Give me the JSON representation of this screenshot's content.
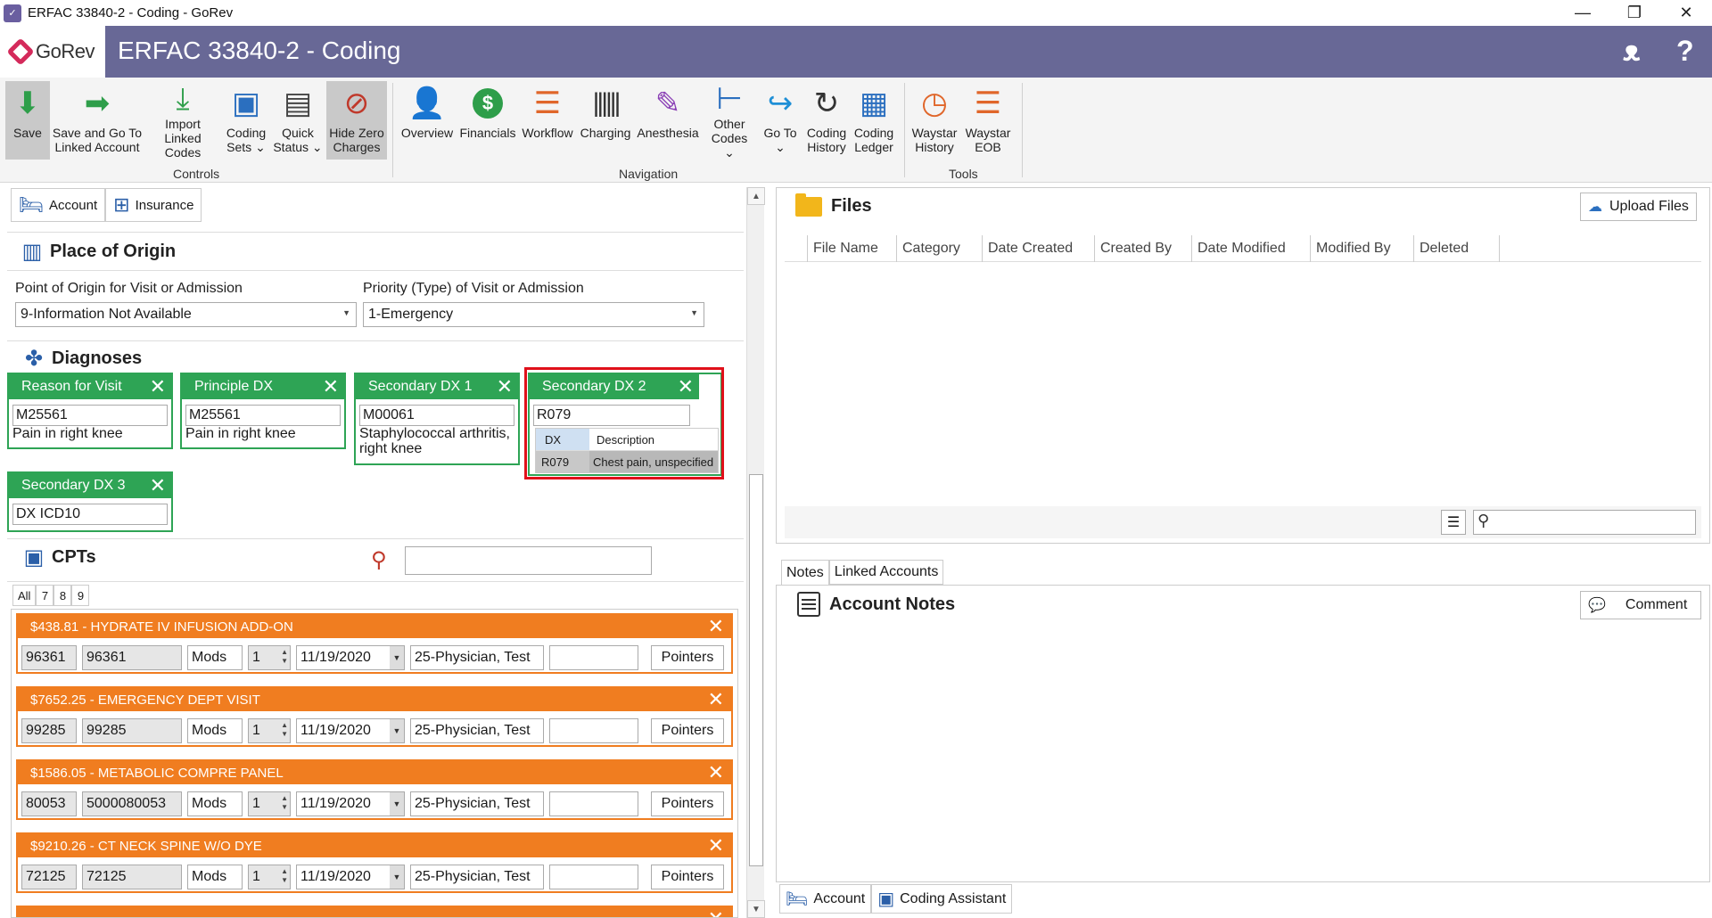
{
  "window": {
    "title": "ERFAC 33840-2 - Coding - GoRev",
    "controls": [
      "—",
      "❐",
      "✕"
    ]
  },
  "header": {
    "logo_text": "GoRev",
    "title": "ERFAC 33840-2 - Coding",
    "accent": "#686896"
  },
  "ribbon": {
    "groups": {
      "controls": "Controls",
      "navigation": "Navigation",
      "tools": "Tools"
    },
    "buttons": {
      "save": "Save",
      "save_go_l1": "Save and Go To",
      "save_go_l2": "Linked Account",
      "import_l1": "Import",
      "import_l2": "Linked Codes",
      "coding_sets_l1": "Coding",
      "coding_sets_l2": "Sets ⌄",
      "quick_status_l1": "Quick",
      "quick_status_l2": "Status ⌄",
      "hide_zero_l1": "Hide Zero",
      "hide_zero_l2": "Charges",
      "overview": "Overview",
      "financials": "Financials",
      "workflow": "Workflow",
      "charging": "Charging",
      "anesthesia": "Anesthesia",
      "other_codes_l1": "Other",
      "other_codes_l2": "Codes ⌄",
      "goto_l1": "Go To",
      "goto_l2": "⌄",
      "coding_history_l1": "Coding",
      "coding_history_l2": "History",
      "coding_ledger_l1": "Coding",
      "coding_ledger_l2": "Ledger",
      "waystar_history_l1": "Waystar",
      "waystar_history_l2": "History",
      "waystar_eob_l1": "Waystar",
      "waystar_eob_l2": "EOB"
    }
  },
  "left": {
    "tabs": {
      "account": "Account",
      "insurance": "Insurance"
    },
    "origin": {
      "title": "Place of Origin",
      "point_label": "Point of Origin for Visit or Admission",
      "point_value": "9-Information Not Available",
      "priority_label": "Priority (Type) of Visit or Admission",
      "priority_value": "1-Emergency"
    },
    "diagnoses": {
      "title": "Diagnoses",
      "cards": [
        {
          "header": "Reason for Visit",
          "code": "M25561",
          "desc": "Pain in right knee"
        },
        {
          "header": "Principle DX",
          "code": "M25561",
          "desc": "Pain in right knee"
        },
        {
          "header": "Secondary DX 1",
          "code": "M00061",
          "desc": "Staphylococcal arthritis, right knee"
        },
        {
          "header": "Secondary DX 2",
          "code": "R079",
          "list_h1": "DX",
          "list_h2": "Description",
          "list_c1": "R079",
          "list_c2": "Chest pain, unspecified"
        },
        {
          "header": "Secondary DX 3",
          "code": "DX ICD10"
        }
      ]
    },
    "cpts": {
      "title": "CPTs",
      "filters": [
        "All",
        "7",
        "8",
        "9"
      ],
      "items": [
        {
          "header": "$438.81 - HYDRATE IV INFUSION ADD-ON",
          "code": "96361",
          "code2": "96361",
          "mods": "Mods",
          "qty": "1",
          "date": "11/19/2020",
          "provider": "25-Physician, Test",
          "pointers": "Pointers"
        },
        {
          "header": "$7652.25 - EMERGENCY DEPT VISIT",
          "code": "99285",
          "code2": "99285",
          "mods": "Mods",
          "qty": "1",
          "date": "11/19/2020",
          "provider": "25-Physician, Test",
          "pointers": "Pointers"
        },
        {
          "header": "$1586.05 - METABOLIC COMPRE PANEL",
          "code": "80053",
          "code2": "5000080053",
          "mods": "Mods",
          "qty": "1",
          "date": "11/19/2020",
          "provider": "25-Physician, Test",
          "pointers": "Pointers"
        },
        {
          "header": "$9210.26 - CT NECK SPINE W/O DYE",
          "code": "72125",
          "code2": "72125",
          "mods": "Mods",
          "qty": "1",
          "date": "11/19/2020",
          "provider": "25-Physician, Test",
          "pointers": "Pointers"
        }
      ]
    }
  },
  "right": {
    "files": {
      "title": "Files",
      "upload": "Upload Files",
      "columns": [
        "File Name",
        "Category",
        "Date Created",
        "Created By",
        "Date Modified",
        "Modified By",
        "Deleted"
      ]
    },
    "notes_tabs": [
      "Notes",
      "Linked Accounts"
    ],
    "notes": {
      "title": "Account Notes",
      "comment": "Comment"
    },
    "bottom_tabs": {
      "account": "Account",
      "coding_assistant": "Coding Assistant"
    }
  }
}
